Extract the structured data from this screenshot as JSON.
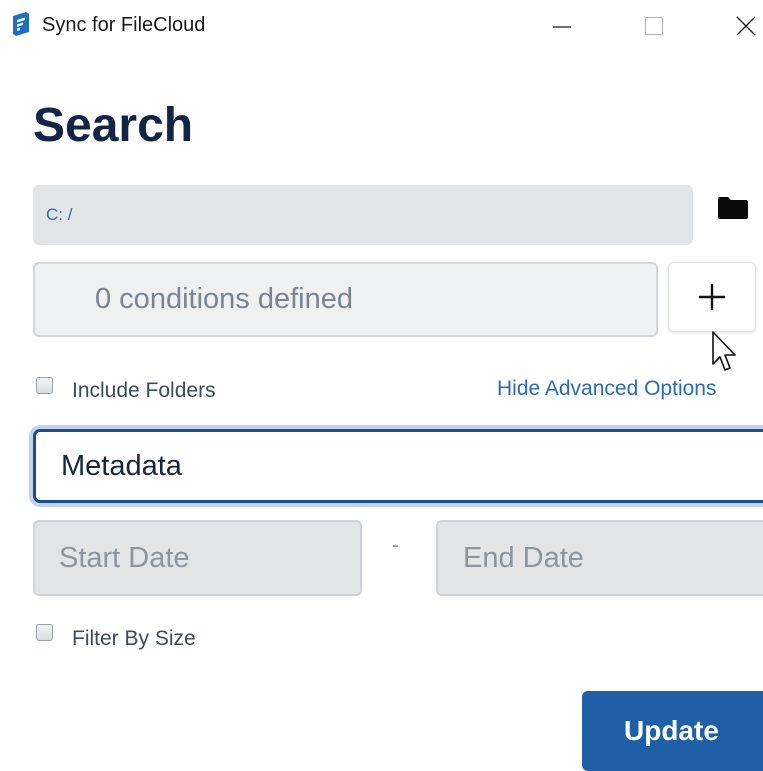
{
  "window": {
    "title": "Sync for FileCloud",
    "icon": "filecloud-logo-icon",
    "controls": [
      "minimize-icon",
      "maximize-icon",
      "close-icon"
    ]
  },
  "page": {
    "heading": "Search"
  },
  "path": {
    "value": "C: /",
    "browse_icon": "folder-icon"
  },
  "conditions": {
    "text": "0 conditions defined",
    "add_icon": "plus-icon"
  },
  "options": {
    "include_folders_label": "Include Folders",
    "include_folders_checked": false,
    "advanced_link": "Hide Advanced Options",
    "filter_by_size_label": "Filter By Size",
    "filter_by_size_checked": false
  },
  "metadata": {
    "selected": "Metadata"
  },
  "dates": {
    "start_placeholder": "Start Date",
    "separator": "-",
    "end_placeholder": "End Date"
  },
  "actions": {
    "update_label": "Update"
  },
  "colors": {
    "accent": "#1e5fa5",
    "link": "#2b6cb5",
    "heading": "#142445"
  }
}
